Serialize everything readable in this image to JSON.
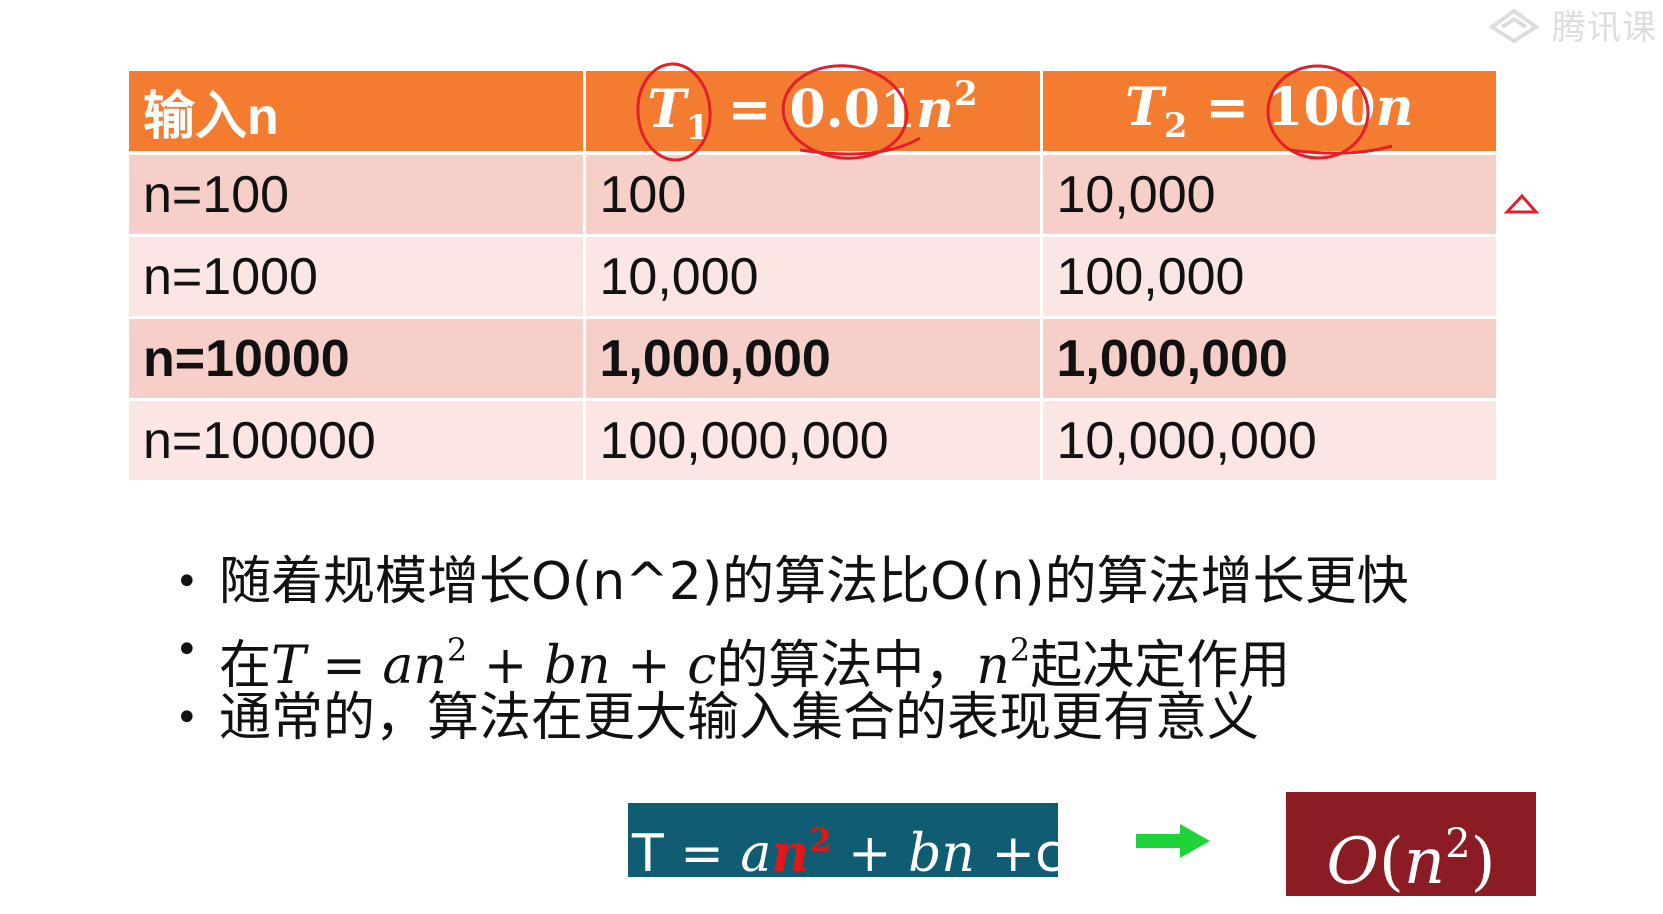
{
  "watermark": {
    "text": "腾讯课",
    "logo_icon": "tencent-classroom-logo-icon"
  },
  "table": {
    "header": {
      "col1": "输入n",
      "col2": {
        "var": "T",
        "sub": "1",
        "eq": " = ",
        "coef": "0.01",
        "n": "n",
        "sup": "2"
      },
      "col3": {
        "var": "T",
        "sub": "2",
        "eq": " = ",
        "coef": "100",
        "n": "n"
      }
    },
    "rows": [
      {
        "n": "n=100",
        "t1": "100",
        "t2": "10,000",
        "bold": false
      },
      {
        "n": "n=1000",
        "t1": "10,000",
        "t2": "100,000",
        "bold": false
      },
      {
        "n": "n=10000",
        "t1": "1,000,000",
        "t2": "1,000,000",
        "bold": true
      },
      {
        "n": "n=100000",
        "t1": "100,000,000",
        "t2": "10,000,000",
        "bold": false
      }
    ],
    "colors": {
      "header_bg": "#f47c30",
      "row_odd": "#f7cfc9",
      "row_even": "#fbe6e3"
    }
  },
  "bullets": {
    "bullet_char": "•",
    "b1": "随着规模增长O(n^2)的算法比O(n)的算法增长更快",
    "b2": {
      "pre": "在",
      "formula_a": "T = an",
      "sup": "2",
      "formula_b": " + bn + c",
      "mid": "的算法中，",
      "n": "n",
      "sup2": "2",
      "post": "起决定作用"
    },
    "b3": "通常的，算法在更大输入集合的表现更有意义"
  },
  "formula_box": {
    "t": "T = ",
    "a": "a",
    "n": "n",
    "sup": "2",
    "rest_it": " + bn ",
    "rest": "+c",
    "bg": "#0f5c73"
  },
  "arrow": {
    "icon": "right-arrow-icon",
    "color": "#1ed43a"
  },
  "result_box": {
    "o": "O",
    "open": "(",
    "n": "n",
    "sup": "2",
    "close": ")",
    "bg": "#8b1c24"
  },
  "annotation": {
    "color": "#e0202a",
    "marks": [
      "circle-around-T1",
      "circle-around-0.01n2",
      "circle-around-100n",
      "triangle-mark"
    ]
  }
}
